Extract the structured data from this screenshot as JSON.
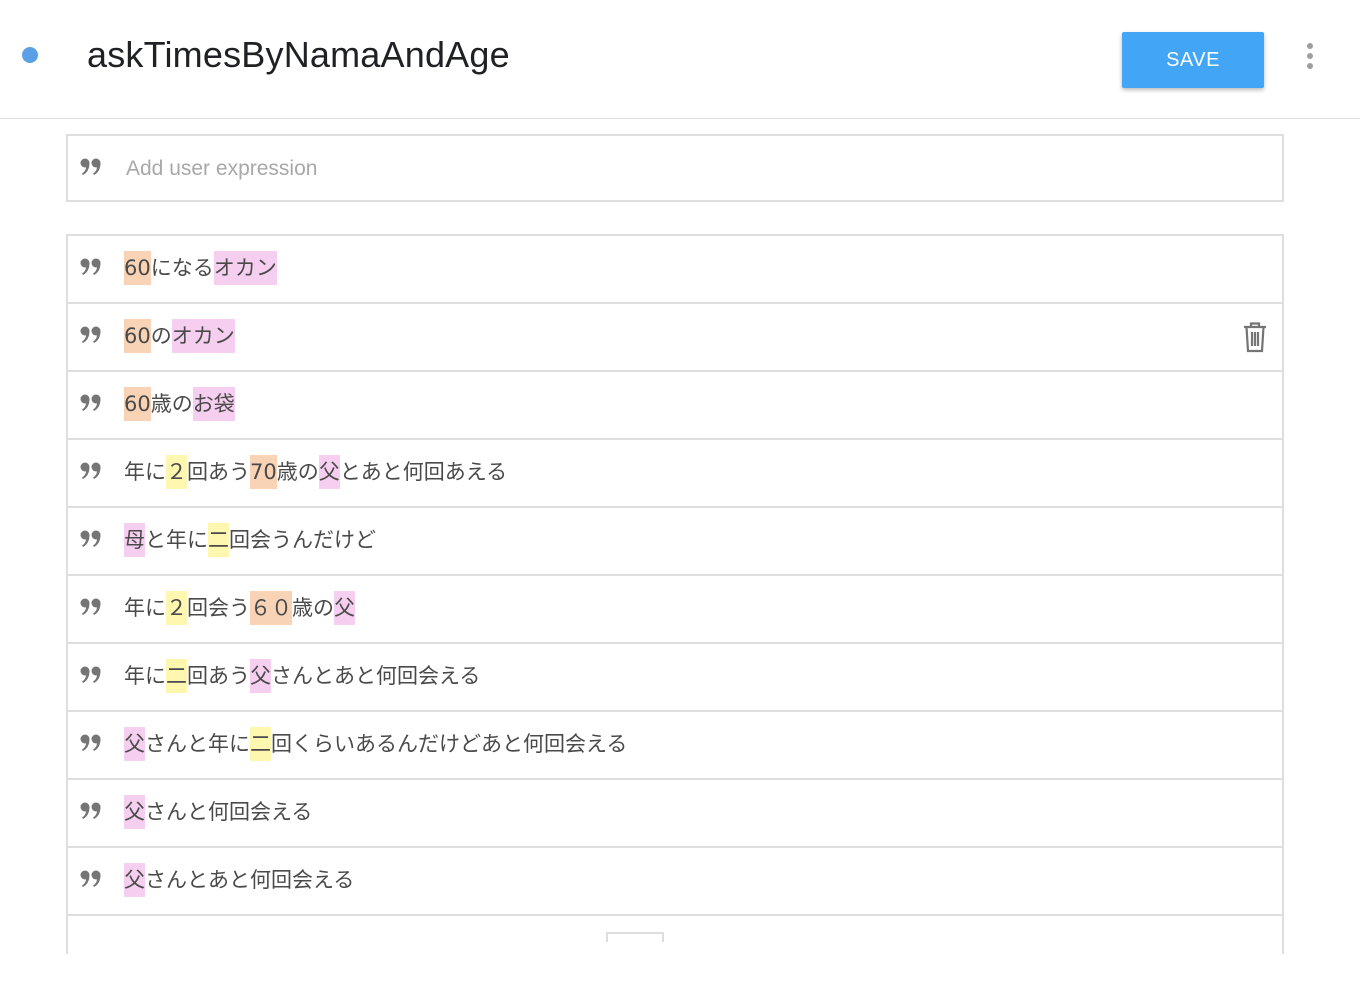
{
  "header": {
    "title": "askTimesByNamaAndAge",
    "save_label": "SAVE",
    "status_color": "#5aa0e6",
    "more_icon": "more-vert-icon"
  },
  "add_expression": {
    "placeholder": "Add user expression",
    "icon": "quote-icon"
  },
  "annotation_colors": {
    "number": "#f9d3b6",
    "person": "#f6cff0",
    "count": "#fdf7b0"
  },
  "expressions": [
    {
      "segments": [
        {
          "text": "60",
          "type": "number"
        },
        {
          "text": "になる",
          "type": "plain"
        },
        {
          "text": "オカン",
          "type": "person"
        }
      ]
    },
    {
      "segments": [
        {
          "text": "60",
          "type": "number"
        },
        {
          "text": "の",
          "type": "plain"
        },
        {
          "text": "オカン",
          "type": "person"
        }
      ],
      "show_delete": true
    },
    {
      "segments": [
        {
          "text": "60",
          "type": "number"
        },
        {
          "text": "歳の",
          "type": "plain"
        },
        {
          "text": "お袋",
          "type": "person"
        }
      ]
    },
    {
      "segments": [
        {
          "text": "年に",
          "type": "plain"
        },
        {
          "text": "２",
          "type": "count"
        },
        {
          "text": "回あう",
          "type": "plain"
        },
        {
          "text": "70",
          "type": "number"
        },
        {
          "text": "歳の",
          "type": "plain"
        },
        {
          "text": "父",
          "type": "person"
        },
        {
          "text": "とあと何回あえる",
          "type": "plain"
        }
      ]
    },
    {
      "segments": [
        {
          "text": "母",
          "type": "person"
        },
        {
          "text": "と年に",
          "type": "plain"
        },
        {
          "text": "二",
          "type": "count"
        },
        {
          "text": "回会うんだけど",
          "type": "plain"
        }
      ]
    },
    {
      "segments": [
        {
          "text": "年に",
          "type": "plain"
        },
        {
          "text": "２",
          "type": "count"
        },
        {
          "text": "回会う",
          "type": "plain"
        },
        {
          "text": "６０",
          "type": "number"
        },
        {
          "text": "歳の",
          "type": "plain"
        },
        {
          "text": "父",
          "type": "person"
        }
      ]
    },
    {
      "segments": [
        {
          "text": "年に",
          "type": "plain"
        },
        {
          "text": "二",
          "type": "count"
        },
        {
          "text": "回あう",
          "type": "plain"
        },
        {
          "text": "父",
          "type": "person"
        },
        {
          "text": "さんとあと何回会える",
          "type": "plain"
        }
      ]
    },
    {
      "segments": [
        {
          "text": "父",
          "type": "person"
        },
        {
          "text": "さんと年に",
          "type": "plain"
        },
        {
          "text": "二",
          "type": "count"
        },
        {
          "text": "回くらいあるんだけどあと何回会える",
          "type": "plain"
        }
      ]
    },
    {
      "segments": [
        {
          "text": "父",
          "type": "person"
        },
        {
          "text": "さんと何回会える",
          "type": "plain"
        }
      ]
    },
    {
      "segments": [
        {
          "text": "父",
          "type": "person"
        },
        {
          "text": "さんとあと何回会える",
          "type": "plain"
        }
      ]
    }
  ]
}
